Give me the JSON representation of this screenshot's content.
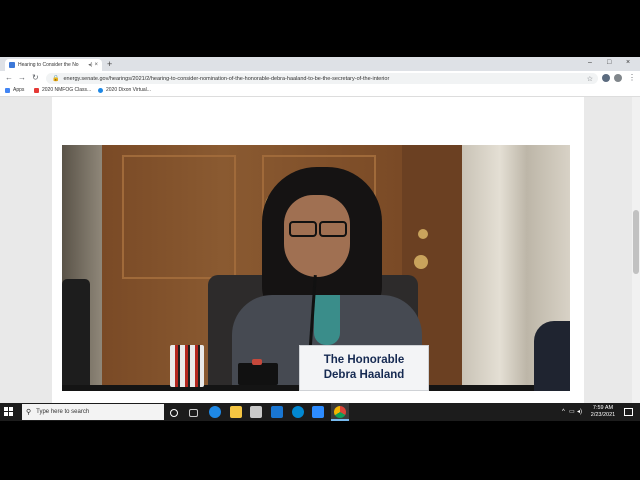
{
  "browser": {
    "tab_title": "Hearing to Consider the No",
    "tab_audio_icon": "speaker-icon",
    "tab_close": "×",
    "new_tab": "+",
    "window_controls": {
      "minimize": "–",
      "maximize": "□",
      "close": "×"
    },
    "nav": {
      "back": "←",
      "forward": "→",
      "reload": "↻"
    },
    "url": "energy.senate.gov/hearings/2021/2/hearing-to-consider-nomination-of-the-honorable-debra-haaland-to-be-the-secretary-of-the-interior",
    "bookmarks": [
      {
        "label": "Apps",
        "color": "#4285f4"
      },
      {
        "label": "2020 NMFOG Class...",
        "color": "#e53935"
      },
      {
        "label": "2020 Dixon Virtual...",
        "color": "#1e88e5"
      }
    ]
  },
  "video": {
    "nameplate_line1": "The Honorable",
    "nameplate_line2": "Debra Haaland"
  },
  "taskbar": {
    "search_placeholder": "Type here to search",
    "time": "7:59 AM",
    "date": "2/23/2021",
    "tray_up": "^"
  },
  "colors": {
    "chrome_tab_strip": "#dee1e6",
    "taskbar": "#1c1c1c",
    "nameplate_text": "#162a52"
  }
}
